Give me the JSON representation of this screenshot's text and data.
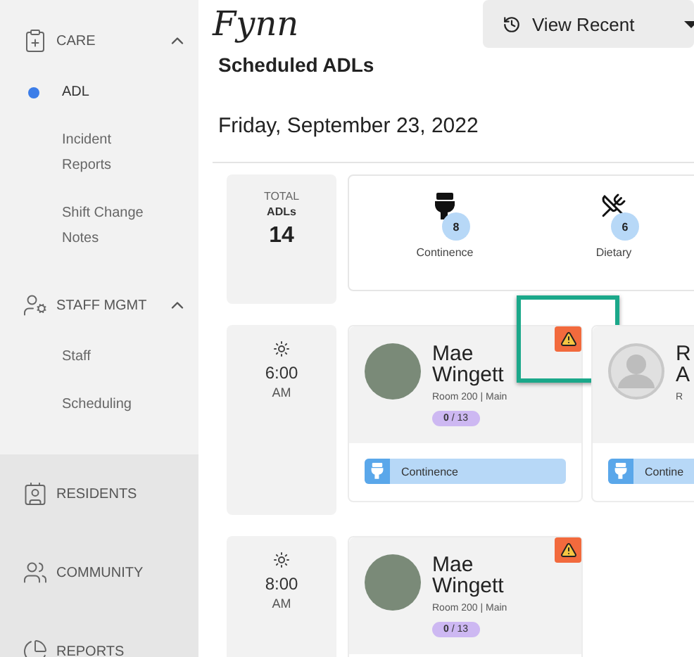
{
  "sidebar": {
    "sections": [
      {
        "kind": "care",
        "label": "CARE",
        "expanded": true,
        "items": [
          {
            "label": "ADL",
            "selected": true
          },
          {
            "label": "Incident Reports",
            "selected": false
          },
          {
            "label": "Shift Change Notes",
            "selected": false
          }
        ]
      },
      {
        "kind": "staff",
        "label": "STAFF MGMT",
        "expanded": true,
        "items": [
          {
            "label": "Staff",
            "selected": false
          },
          {
            "label": "Scheduling",
            "selected": false
          }
        ]
      }
    ],
    "links": [
      {
        "kind": "residents",
        "label": "RESIDENTS"
      },
      {
        "kind": "community",
        "label": "COMMUNITY"
      },
      {
        "kind": "reports",
        "label": "REPORTS"
      }
    ]
  },
  "header": {
    "logo": "Fynn",
    "view_button": "View Recent"
  },
  "title": "Scheduled ADLs",
  "date": "Friday, September 23, 2022",
  "summary": {
    "total_label": "TOTAL",
    "total_unit": "ADLs",
    "total": "14",
    "categories": [
      {
        "kind": "continence",
        "label": "Continence",
        "count": "8"
      },
      {
        "kind": "dietary",
        "label": "Dietary",
        "count": "6"
      }
    ]
  },
  "slots": [
    {
      "time": "6:00",
      "period": "AM",
      "residents": [
        {
          "name_lines": [
            "Mae",
            "Wingett"
          ],
          "has_photo": true,
          "room": "Room 200 | Main",
          "progress": "**0** / 13",
          "alert": true,
          "highlighted": true,
          "tags": [
            {
              "kind": "continence",
              "label": "Continence"
            }
          ]
        },
        {
          "name_lines": [
            "R",
            "A"
          ],
          "has_photo": false,
          "room": "R",
          "alert": false,
          "highlighted": false,
          "tags": [
            {
              "kind": "continence",
              "label": "Contine"
            }
          ]
        }
      ]
    },
    {
      "time": "8:00",
      "period": "AM",
      "residents": [
        {
          "name_lines": [
            "Mae",
            "Wingett"
          ],
          "has_photo": true,
          "room": "Room 200 | Main",
          "progress": "**0** / 13",
          "alert": true,
          "highlighted": false
        }
      ]
    }
  ]
}
